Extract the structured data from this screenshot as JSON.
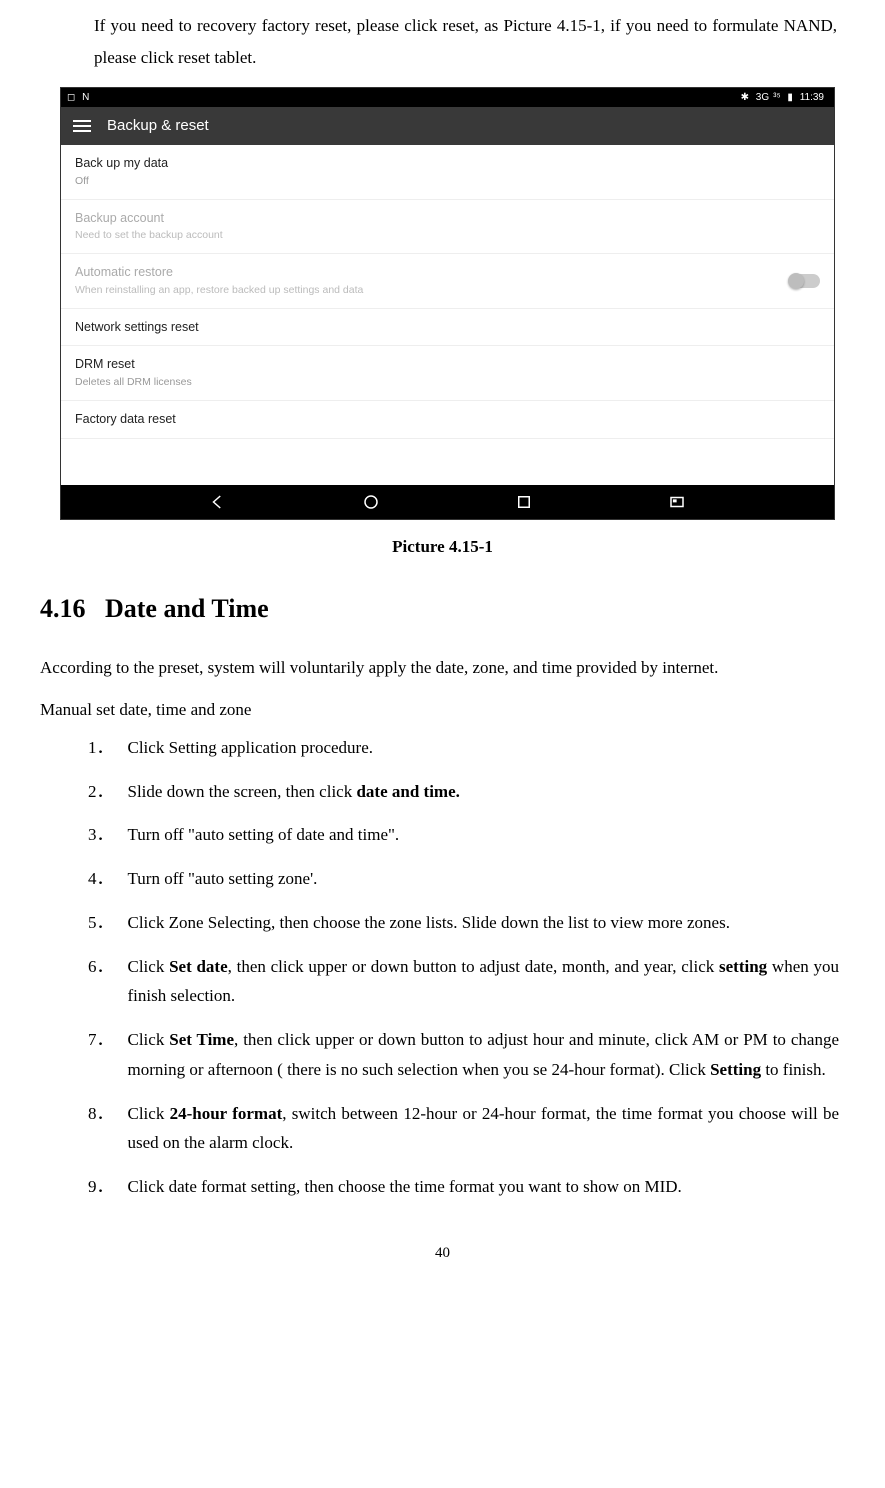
{
  "intro": "If you need to recovery factory reset, please click reset, as Picture 4.15-1, if you need to formulate NAND, please click reset tablet.",
  "status": {
    "left1": "◻",
    "left2": "N",
    "bt": "✱",
    "net": "3G",
    "sig": "³⁵",
    "bat": "▮",
    "time": "11:39"
  },
  "app_title": "Backup & reset",
  "rows": {
    "r1t": "Back up my data",
    "r1s": "Off",
    "r2t": "Backup account",
    "r2s": "Need to set the backup account",
    "r3t": "Automatic restore",
    "r3s": "When reinstalling an app, restore backed up settings and data",
    "r4t": "Network settings reset",
    "r5t": "DRM reset",
    "r5s": "Deletes all DRM licenses",
    "r6t": "Factory data reset"
  },
  "caption": "Picture 4.15-1",
  "section_num": "4.16",
  "section_title": "Date and Time",
  "para1": "According to the preset, system will voluntarily apply the date, zone, and time provided by internet.",
  "para2": "Manual set date, time and zone",
  "steps": {
    "n1": "1．",
    "t1": "Click Setting application procedure.",
    "n2": "2．",
    "t2_a": "Slide down the screen, then click ",
    "t2_b": "date and time.",
    "n3": "3．",
    "t3": "Turn off \"auto setting of date and time\".",
    "n4": "4．",
    "t4": "Turn off \"auto setting zone'.",
    "n5": "5．",
    "t5": "Click Zone Selecting, then choose the zone lists. Slide down the list to view more zones.",
    "n6": "6．",
    "t6_a": "Click ",
    "t6_b": "Set date",
    "t6_c": ", then click upper or down button to adjust date, month, and year, click ",
    "t6_d": "setting",
    "t6_e": " when you finish selection.",
    "n7": "7．",
    "t7_a": "Click ",
    "t7_b": "Set Time",
    "t7_c": ", then click upper or down button to adjust hour and minute, click AM or PM to change morning or afternoon ( there is no such selection when you se 24-hour format). Click ",
    "t7_d": "Setting",
    "t7_e": " to finish.",
    "n8": "8．",
    "t8_a": "Click ",
    "t8_b": "24-hour format",
    "t8_c": ", switch between 12-hour or 24-hour format, the time format you choose will be used on the alarm clock.",
    "n9": "9．",
    "t9": "Click date format setting, then choose the time format you want to show on MID."
  },
  "page": "40"
}
